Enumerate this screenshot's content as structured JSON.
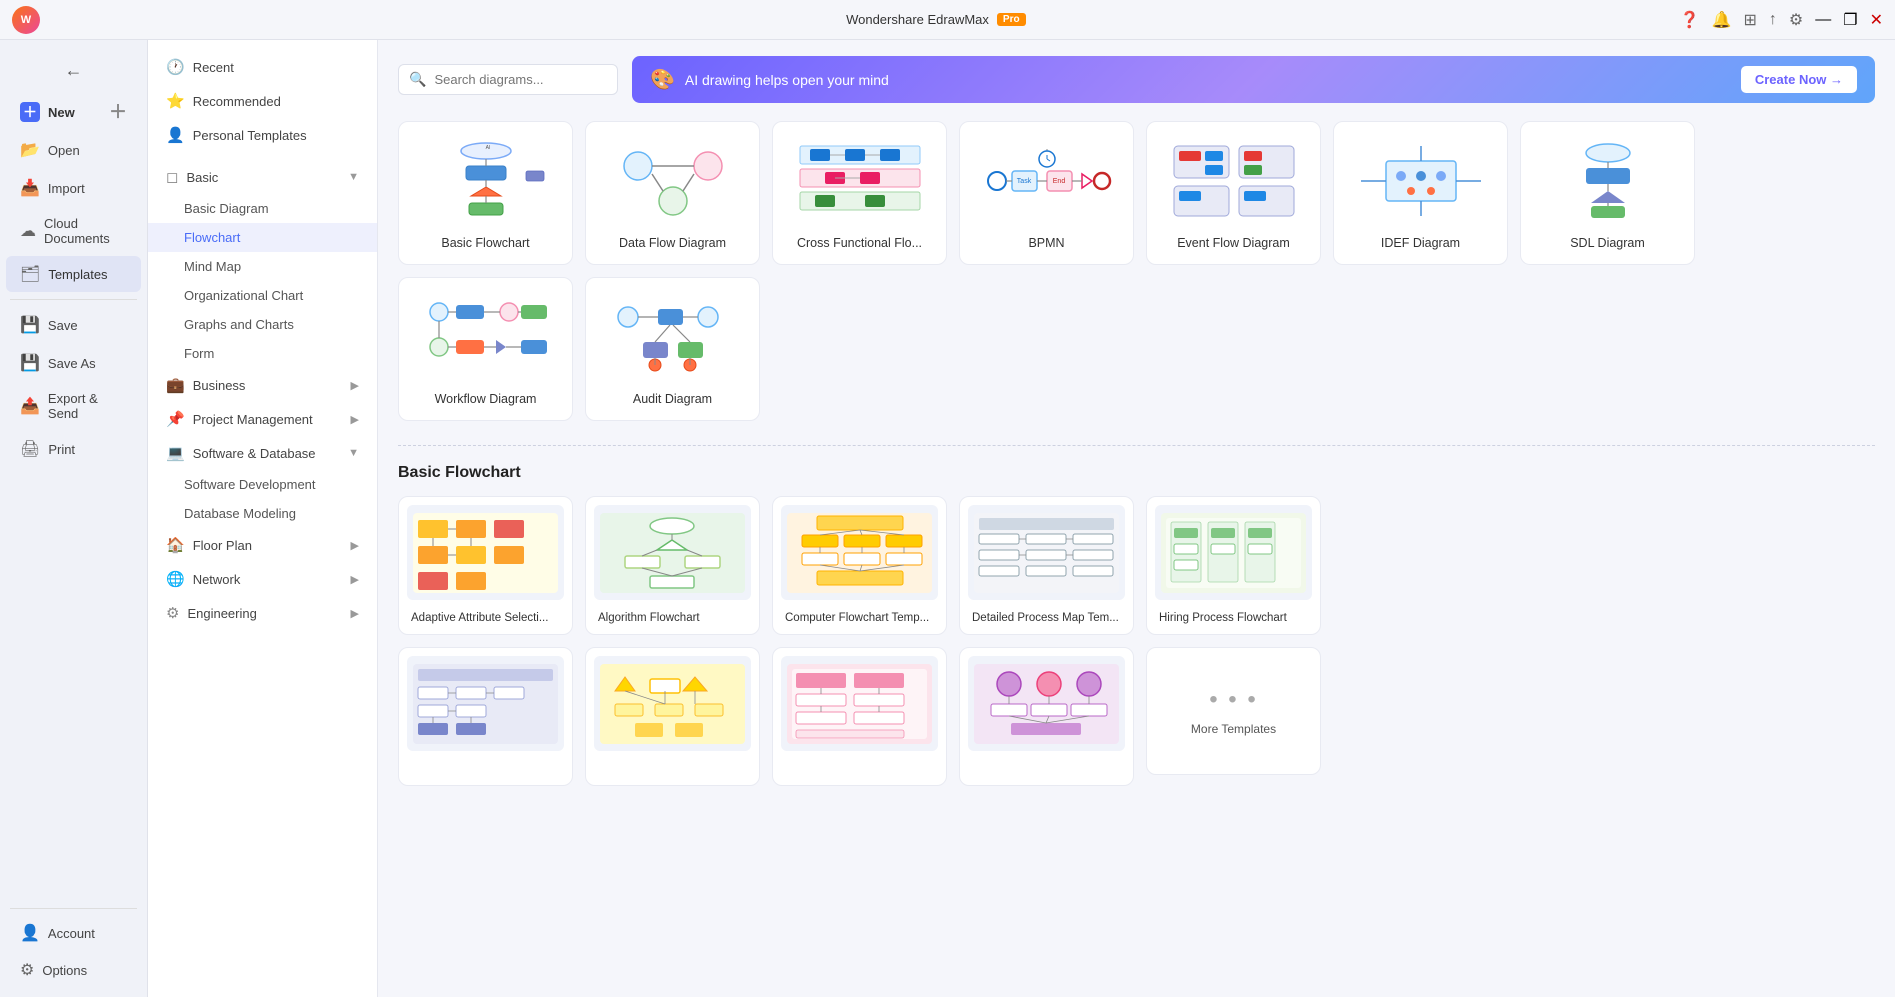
{
  "app": {
    "title": "Wondershare EdrawMax",
    "pro_badge": "Pro"
  },
  "titlebar": {
    "minimize": "—",
    "restore": "❐",
    "close": "✕"
  },
  "sidebar": {
    "back_icon": "←",
    "items": [
      {
        "id": "new",
        "label": "New",
        "icon": "＋",
        "has_add": true
      },
      {
        "id": "open",
        "label": "Open",
        "icon": "📂"
      },
      {
        "id": "import",
        "label": "Import",
        "icon": "📥"
      },
      {
        "id": "cloud",
        "label": "Cloud Documents",
        "icon": "☁"
      },
      {
        "id": "templates",
        "label": "Templates",
        "icon": "🗂",
        "active": true
      }
    ],
    "bottom_items": [
      {
        "id": "save",
        "label": "Save",
        "icon": "💾"
      },
      {
        "id": "save-as",
        "label": "Save As",
        "icon": "💾"
      },
      {
        "id": "export",
        "label": "Export & Send",
        "icon": "📤"
      },
      {
        "id": "print",
        "label": "Print",
        "icon": "🖨"
      }
    ],
    "account": {
      "label": "Account",
      "icon": "👤"
    },
    "options": {
      "label": "Options",
      "icon": "⚙"
    }
  },
  "categories": {
    "top_items": [
      {
        "id": "recent",
        "label": "Recent",
        "icon": "🕐"
      },
      {
        "id": "recommended",
        "label": "Recommended",
        "icon": "⭐"
      },
      {
        "id": "personal",
        "label": "Personal Templates",
        "icon": "👤"
      }
    ],
    "sections": [
      {
        "id": "basic",
        "label": "Basic",
        "icon": "◻",
        "expanded": true,
        "children": [
          {
            "id": "basic-diagram",
            "label": "Basic Diagram",
            "active": false
          },
          {
            "id": "flowchart",
            "label": "Flowchart",
            "active": true
          }
        ]
      },
      {
        "id": "mind-map",
        "label": "Mind Map",
        "icon": "🧠",
        "indent": true
      },
      {
        "id": "org-chart",
        "label": "Organizational Chart",
        "icon": "📊",
        "indent": true
      },
      {
        "id": "graphs",
        "label": "Graphs and Charts",
        "icon": "📈",
        "indent": true
      },
      {
        "id": "form",
        "label": "Form",
        "icon": "📋",
        "indent": true
      },
      {
        "id": "business",
        "label": "Business",
        "icon": "💼",
        "expanded": false
      },
      {
        "id": "project",
        "label": "Project Management",
        "icon": "📌",
        "expanded": false
      },
      {
        "id": "software",
        "label": "Software & Database",
        "icon": "💻",
        "expanded": true,
        "children": [
          {
            "id": "software-dev",
            "label": "Software Development",
            "active": false
          },
          {
            "id": "db-modeling",
            "label": "Database Modeling",
            "active": false
          }
        ]
      },
      {
        "id": "floor-plan",
        "label": "Floor Plan",
        "icon": "🏠",
        "expanded": false
      },
      {
        "id": "network",
        "label": "Network",
        "icon": "🌐",
        "expanded": false
      },
      {
        "id": "engineering",
        "label": "Engineering",
        "icon": "⚙",
        "expanded": false
      }
    ]
  },
  "search": {
    "placeholder": "Search diagrams..."
  },
  "ai_banner": {
    "icon": "🎨",
    "text": "AI drawing helps open your mind",
    "button_label": "Create Now →"
  },
  "diagram_types": [
    {
      "id": "basic-flowchart",
      "label": "Basic Flowchart",
      "type": "flowchart_basic"
    },
    {
      "id": "data-flow",
      "label": "Data Flow Diagram",
      "type": "data_flow"
    },
    {
      "id": "cross-functional",
      "label": "Cross Functional Flo...",
      "type": "cross_functional"
    },
    {
      "id": "bpmn",
      "label": "BPMN",
      "type": "bpmn"
    },
    {
      "id": "event-flow",
      "label": "Event Flow Diagram",
      "type": "event_flow"
    },
    {
      "id": "idef",
      "label": "IDEF Diagram",
      "type": "idef"
    },
    {
      "id": "sdl",
      "label": "SDL Diagram",
      "type": "sdl"
    },
    {
      "id": "workflow",
      "label": "Workflow Diagram",
      "type": "workflow"
    },
    {
      "id": "audit",
      "label": "Audit Diagram",
      "type": "audit"
    }
  ],
  "basic_flowchart_section": {
    "title": "Basic Flowchart",
    "templates": [
      {
        "id": "adaptive",
        "label": "Adaptive Attribute Selecti...",
        "type": "tpl_adaptive"
      },
      {
        "id": "algorithm",
        "label": "Algorithm Flowchart",
        "type": "tpl_algorithm"
      },
      {
        "id": "computer-fc",
        "label": "Computer Flowchart Temp...",
        "type": "tpl_computer"
      },
      {
        "id": "detailed-process",
        "label": "Detailed Process Map Tem...",
        "type": "tpl_detailed"
      },
      {
        "id": "hiring",
        "label": "Hiring Process Flowchart",
        "type": "tpl_hiring"
      }
    ],
    "second_row": [
      {
        "id": "row2_1",
        "label": "",
        "type": "tpl_r2_1"
      },
      {
        "id": "row2_2",
        "label": "",
        "type": "tpl_r2_2"
      },
      {
        "id": "row2_3",
        "label": "",
        "type": "tpl_r2_3"
      },
      {
        "id": "more",
        "label": "More Templates",
        "type": "more"
      }
    ]
  },
  "colors": {
    "accent": "#4a6cf7",
    "pro_orange": "#ff8c00",
    "ai_gradient_start": "#6c63ff",
    "ai_gradient_end": "#60a5fa",
    "card_border": "#e8eaf2",
    "bg": "#f5f6fb",
    "sidebar_bg": "#f0f2f8"
  }
}
